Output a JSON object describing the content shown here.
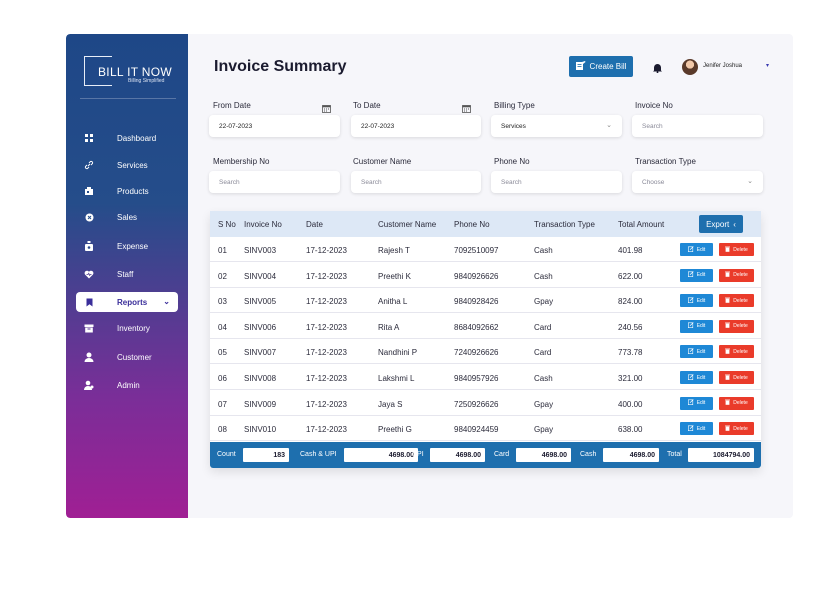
{
  "brand": {
    "title": "BILL IT NOW",
    "subtitle": "Billing Simplified"
  },
  "sidebar": {
    "items": [
      {
        "label": "Dashboard",
        "icon": "grid-icon"
      },
      {
        "label": "Services",
        "icon": "link-icon"
      },
      {
        "label": "Products",
        "icon": "box-icon"
      },
      {
        "label": "Sales",
        "icon": "sales-icon"
      },
      {
        "label": "Expense",
        "icon": "money-bag-icon"
      },
      {
        "label": "Staff",
        "icon": "heart-icon"
      },
      {
        "label": "Reports",
        "icon": "bookmark-icon",
        "active": true
      },
      {
        "label": "Inventory",
        "icon": "inventory-icon"
      },
      {
        "label": "Customer",
        "icon": "customer-icon"
      },
      {
        "label": "Admin",
        "icon": "admin-icon"
      }
    ],
    "active_chevron": "⌄"
  },
  "header": {
    "title": "Invoice Summary",
    "create_bill_label": "Create Bill",
    "user_name": "Jenifer Joshua",
    "user_caret": "▾"
  },
  "filters": {
    "from_date": {
      "label": "From Date",
      "value": "22-07-2023"
    },
    "to_date": {
      "label": "To Date",
      "value": "22-07-2023"
    },
    "billing_type": {
      "label": "Billing Type",
      "value": "Services"
    },
    "invoice_no": {
      "label": "Invoice No",
      "placeholder": "Search"
    },
    "membership_no": {
      "label": "Membership No",
      "placeholder": "Search"
    },
    "customer_name": {
      "label": "Customer Name",
      "placeholder": "Search"
    },
    "phone_no": {
      "label": "Phone No",
      "placeholder": "Search"
    },
    "transaction_type": {
      "label": "Transaction Type",
      "value": "Choose"
    }
  },
  "table": {
    "columns": [
      "S No",
      "Invoice No",
      "Date",
      "Customer Name",
      "Phone No",
      "Transaction Type",
      "Total Amount"
    ],
    "export_label": "Export",
    "edit_label": "Edit",
    "delete_label": "Delete",
    "rows": [
      [
        "01",
        "SINV003",
        "17-12-2023",
        "Rajesh T",
        "7092510097",
        "Cash",
        "401.98"
      ],
      [
        "02",
        "SINV004",
        "17-12-2023",
        "Preethi K",
        "9840926626",
        "Cash",
        "622.00"
      ],
      [
        "03",
        "SINV005",
        "17-12-2023",
        "Anitha L",
        "9840928426",
        "Gpay",
        "824.00"
      ],
      [
        "04",
        "SINV006",
        "17-12-2023",
        "Rita A",
        "8684092662",
        "Card",
        "240.56"
      ],
      [
        "05",
        "SINV007",
        "17-12-2023",
        "Nandhini P",
        "7240926626",
        "Card",
        "773.78"
      ],
      [
        "06",
        "SINV008",
        "17-12-2023",
        "Lakshmi L",
        "9840957926",
        "Cash",
        "321.00"
      ],
      [
        "07",
        "SINV009",
        "17-12-2023",
        "Jaya S",
        "7250926626",
        "Gpay",
        "400.00"
      ],
      [
        "08",
        "SINV010",
        "17-12-2023",
        "Preethi G",
        "9840924459",
        "Gpay",
        "638.00"
      ]
    ]
  },
  "summary": {
    "count": {
      "label": "Count",
      "value": "183"
    },
    "cash_upi": {
      "label": "Cash & UPI",
      "value": "4698.00"
    },
    "upi": {
      "label": "UPI",
      "value": "4698.00"
    },
    "card": {
      "label": "Card",
      "value": "4698.00"
    },
    "cash": {
      "label": "Cash",
      "value": "4698.00"
    },
    "total": {
      "label": "Total",
      "value": "1084794.00"
    }
  },
  "colors": {
    "primary": "#1e6fae",
    "edit": "#1e88d6",
    "delete": "#ea3b2a",
    "active_text": "#3a2e9a"
  }
}
